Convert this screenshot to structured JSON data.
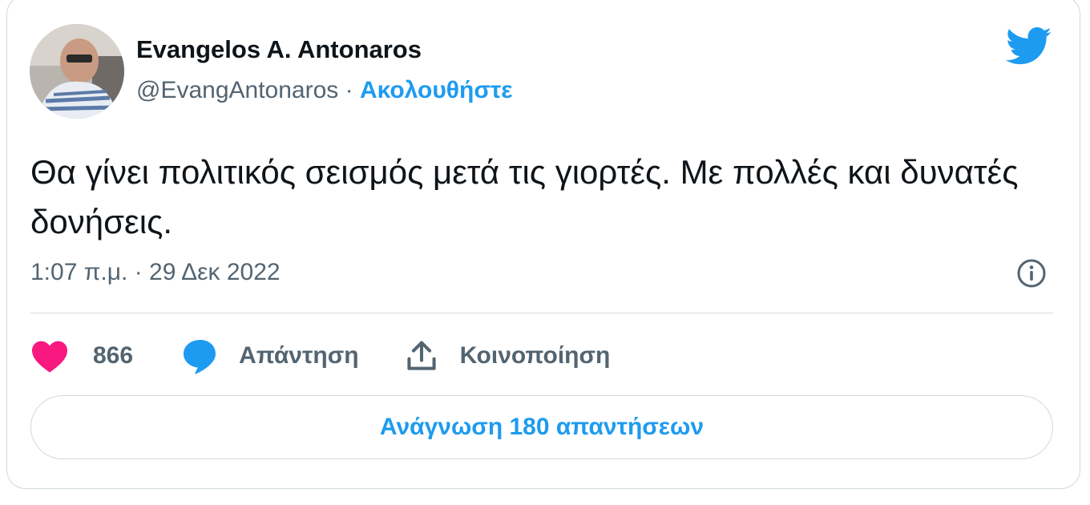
{
  "author": {
    "name": "Evangelos A. Antonaros",
    "handle": "@EvangAntonaros",
    "separator": " · ",
    "follow_label": "Ακολουθήστε"
  },
  "tweet": {
    "text": "Θα γίνει πολιτικός σεισμός μετά τις γιορτές. Με πολλές και δυνατές δονήσεις.",
    "timestamp": "1:07 π.μ. · 29 Δεκ 2022"
  },
  "actions": {
    "like_count": "866",
    "reply_label": "Απάντηση",
    "share_label": "Κοινοποίηση"
  },
  "footer": {
    "read_replies_label": "Ανάγνωση 180 απαντήσεων"
  },
  "icons": {
    "brand": "twitter-bird-icon",
    "info": "info-icon",
    "like": "heart-icon",
    "reply": "speech-bubble-icon",
    "share": "share-upload-icon"
  },
  "colors": {
    "accent": "#1d9bf0",
    "like": "#f91880",
    "text_primary": "#0f1419",
    "text_secondary": "#536471",
    "border": "#cfd9de"
  }
}
